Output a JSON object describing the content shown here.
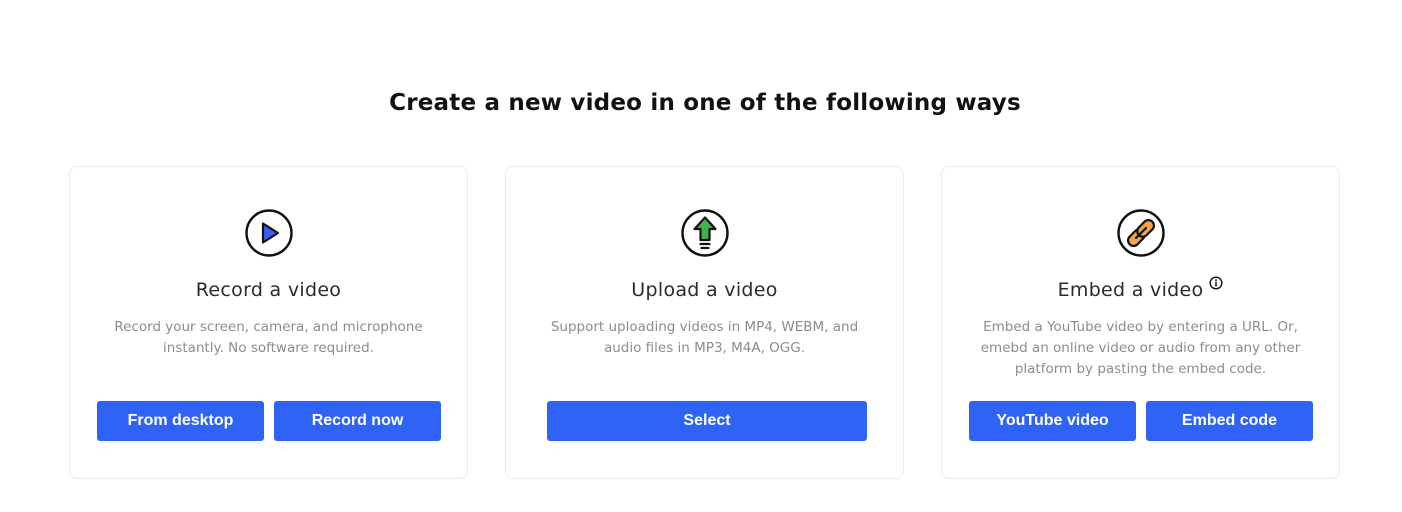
{
  "headline": "Create a new video in one of the following ways",
  "cards": [
    {
      "icon": "play-icon",
      "title": "Record a video",
      "description": "Record your screen, camera, and microphone instantly. No software required.",
      "buttons": [
        "From desktop",
        "Record now"
      ]
    },
    {
      "icon": "upload-arrow-icon",
      "title": "Upload a video",
      "description": "Support uploading videos in MP4, WEBM, and audio files in MP3, M4A, OGG.",
      "buttons": [
        "Select"
      ]
    },
    {
      "icon": "link-icon",
      "title": "Embed a video",
      "description": "Embed a YouTube video by entering a URL. Or, emebd an online video or audio from any other platform by pasting the embed code.",
      "buttons": [
        "YouTube video",
        "Embed code"
      ],
      "has_info_icon": true
    }
  ],
  "colors": {
    "primary_button": "#2e63f6",
    "play_accent": "#3b5cf6",
    "upload_accent": "#3fb34f",
    "link_accent": "#f5a44a"
  }
}
